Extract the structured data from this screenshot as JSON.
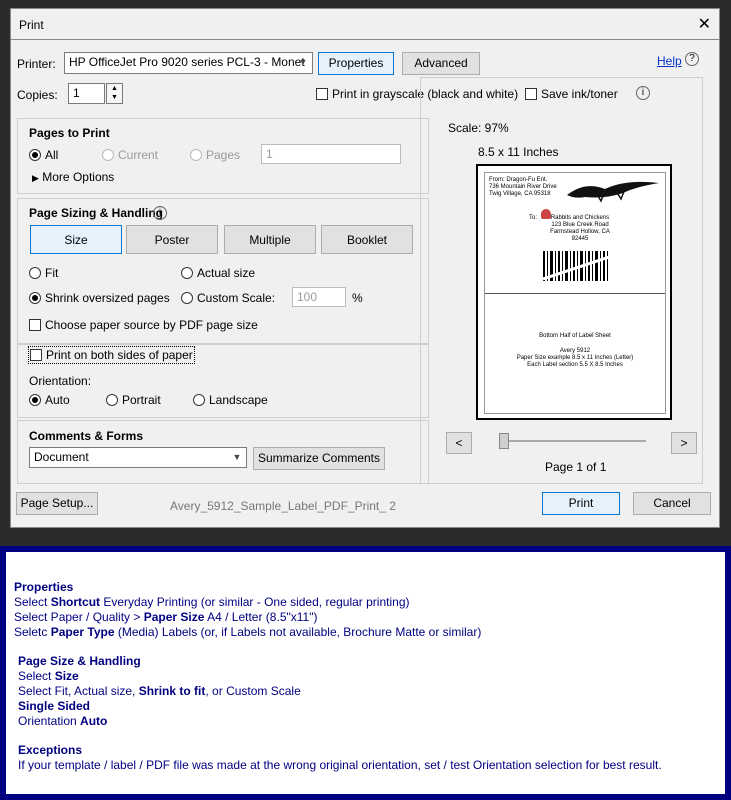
{
  "window": {
    "title": "Print",
    "close_icon": "close-icon"
  },
  "top": {
    "printer_label": "Printer:",
    "printer_value": "HP OfficeJet Pro 9020 series PCL-3 - Monet",
    "properties_label": "Properties",
    "advanced_label": "Advanced",
    "help_label": "Help",
    "copies_label": "Copies:",
    "copies_value": "1",
    "grayscale_label": "Print in grayscale (black and white)",
    "save_ink_label": "Save ink/toner"
  },
  "pages_to_print": {
    "title": "Pages to Print",
    "all_label": "All",
    "current_label": "Current",
    "pages_label": "Pages",
    "pages_value": "1",
    "more_options_label": "More Options"
  },
  "sizing": {
    "title": "Page Sizing & Handling",
    "tabs": [
      "Size",
      "Poster",
      "Multiple",
      "Booklet"
    ],
    "fit_label": "Fit",
    "actual_size_label": "Actual size",
    "shrink_label": "Shrink oversized pages",
    "custom_scale_label": "Custom Scale:",
    "custom_scale_value": "100",
    "percent": "%",
    "choose_source_label": "Choose paper source by PDF page size"
  },
  "duplex": {
    "label": "Print on both sides of paper"
  },
  "orientation": {
    "title": "Orientation:",
    "auto_label": "Auto",
    "portrait_label": "Portrait",
    "landscape_label": "Landscape"
  },
  "comments": {
    "title": "Comments & Forms",
    "value": "Document",
    "summarize_label": "Summarize Comments"
  },
  "preview": {
    "scale": "Scale:  97%",
    "paper": "8.5 x 11 Inches",
    "from_line1": "From:  Dragon-Fu Ent.",
    "from_line2": "736 Mountain River Drive",
    "from_line3": "Twig Village, CA 95318",
    "to_label": "To:",
    "to_line1": "Rabbits and Chickens",
    "to_line2": "123 Blue Creek Road",
    "to_line3": "Farmstead Hollow, CA 92445",
    "bottom_line1": "Bottom Half of Label Sheet",
    "bottom_line2": "Avery 5912",
    "bottom_line3": "Paper Size example 8.5 x 11 Inches (Letter)",
    "bottom_line4": "Each Label section 5.5 X 8.5 Inches",
    "prev_label": "<",
    "next_label": ">",
    "page_of": "Page 1 of 1"
  },
  "footer": {
    "page_setup_label": "Page Setup...",
    "doc_name": "Avery_5912_Sample_Label_PDF_Print_ 2",
    "print_label": "Print",
    "cancel_label": "Cancel"
  },
  "help_text": {
    "l1": "Properties",
    "l2a": "Select ",
    "l2b": "Shortcut",
    "l2c": " Everyday Printing (or similar - One sided, regular printing)",
    "l3a": "Select Paper / Quality > ",
    "l3b": "Paper Size",
    "l3c": " A4  /  Letter (8.5\"x11\")",
    "l4a": "Seletc ",
    "l4b": "Paper Type",
    "l4c": " (Media) Labels (or, if Labels not available, Brochure Matte or similar)",
    "l5": "Page Size & Handling",
    "l6a": "Select ",
    "l6b": "Size",
    "l7a": "Select Fit, Actual size, ",
    "l7b": "Shrink to fit",
    "l7c": ", or Custom Scale",
    "l8": "Single Sided",
    "l9a": "Orientation ",
    "l9b": "Auto",
    "l10": "Exceptions",
    "l11": "If your template / label / PDF file was made at the wrong original orientation, set / test Orientation selection for best result."
  }
}
